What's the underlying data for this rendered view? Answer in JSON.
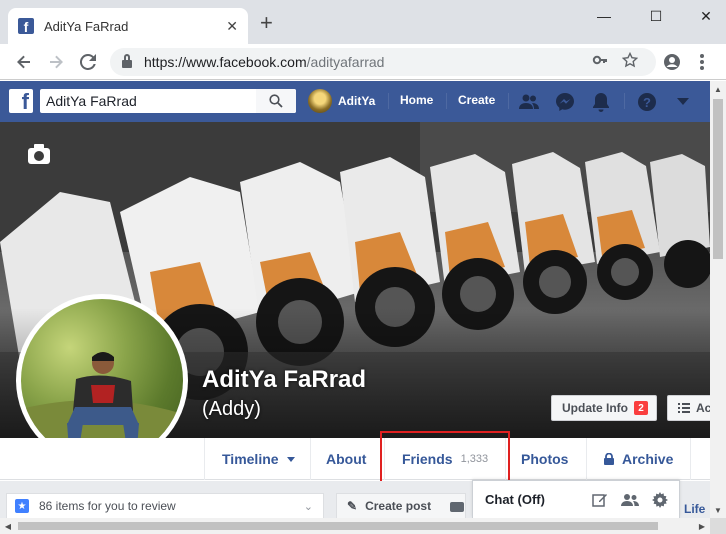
{
  "browser": {
    "tab_title": "AditYa FaRrad",
    "tab_favicon": "f",
    "tab_close": "✕",
    "new_tab": "+",
    "minimize": "—",
    "maximize": "☐",
    "close": "✕",
    "url_host": "https://www.facebook.com",
    "url_path": "/adityafarrad"
  },
  "fb": {
    "logo": "f",
    "search_value": "AditYa FaRrad",
    "user_name": "AditYa",
    "nav_home": "Home",
    "nav_create": "Create"
  },
  "profile": {
    "name": "AditYa FaRrad",
    "nickname": "(Addy)",
    "update_info_label": "Update Info",
    "update_info_badge": "2",
    "activity_label": "Ac"
  },
  "profile_nav": {
    "timeline": "Timeline",
    "about": "About",
    "friends": "Friends",
    "friends_count": "1,333",
    "photos": "Photos",
    "archive": "Archive"
  },
  "content": {
    "review_text": "86 items for you to review",
    "create_post": "Create post",
    "life_event": "Life"
  },
  "chat": {
    "title": "Chat (Off)"
  },
  "colors": {
    "fb_blue": "#3b5998",
    "link_blue": "#365899",
    "highlight_red": "#e02020"
  }
}
